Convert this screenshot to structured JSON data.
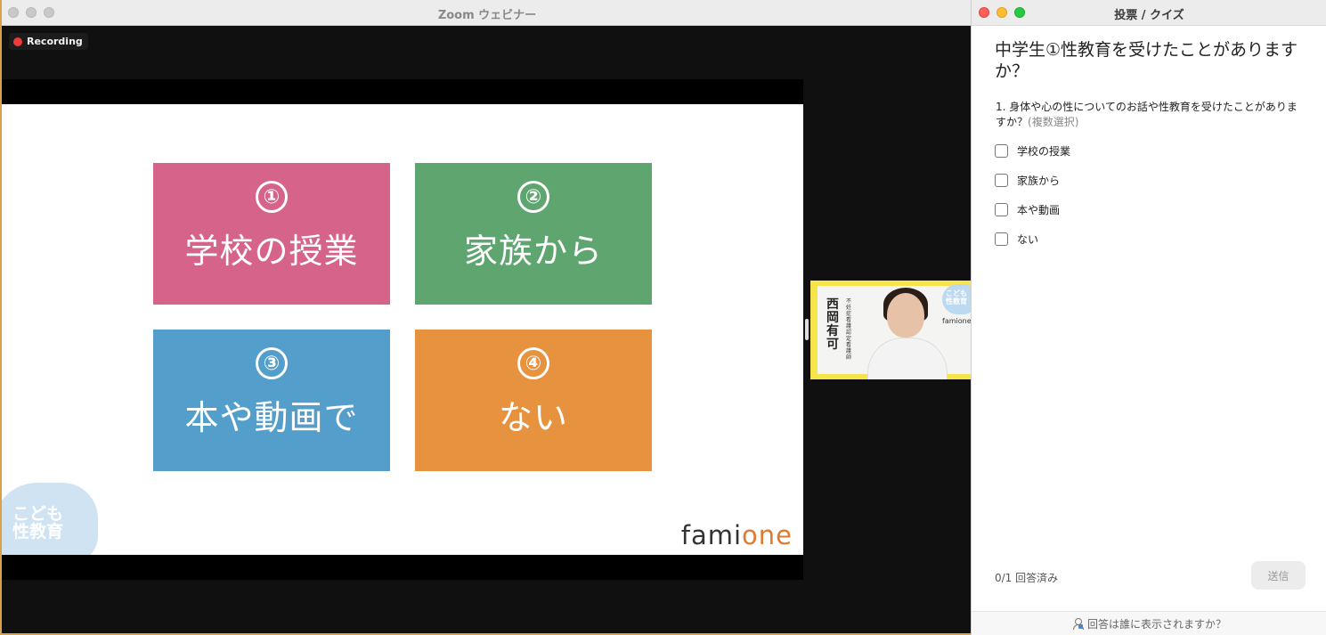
{
  "zoom": {
    "title": "Zoom ウェビナー",
    "recording_label": "Recording"
  },
  "slide": {
    "tiles": [
      {
        "num": "①",
        "label": "学校の授業",
        "color": "#d6648a"
      },
      {
        "num": "②",
        "label": "家族から",
        "color": "#5ea56f"
      },
      {
        "num": "③",
        "label": "本や動画で",
        "color": "#539ecb"
      },
      {
        "num": "④",
        "label": "ない",
        "color": "#e6923e"
      }
    ],
    "badge_line1": "こども",
    "badge_line2": "性教育",
    "logo_a": "fami",
    "logo_b": "one"
  },
  "video": {
    "speaker_name": "西岡有可",
    "speaker_title": "不妊症看護認定看護師",
    "badge_line1": "こども",
    "badge_line2": "性教育",
    "logo": "famione"
  },
  "poll": {
    "window_title": "投票 / クイズ",
    "heading": "中学生①性教育を受けたことがありますか？",
    "question": "1. 身体や心の性についてのお話や性教育を受けたことがありますか？",
    "question_hint": "(複数選択)",
    "options": [
      "学校の授業",
      "家族から",
      "本や動画",
      "ない"
    ],
    "answered": "0/1 回答済み",
    "submit": "送信",
    "footer": "回答は誰に表示されますか？"
  },
  "colors": {
    "accent_orange": "#e07a2f",
    "traffic_red": "#ff5f57",
    "traffic_yellow": "#febc2e",
    "traffic_green": "#28c840"
  }
}
